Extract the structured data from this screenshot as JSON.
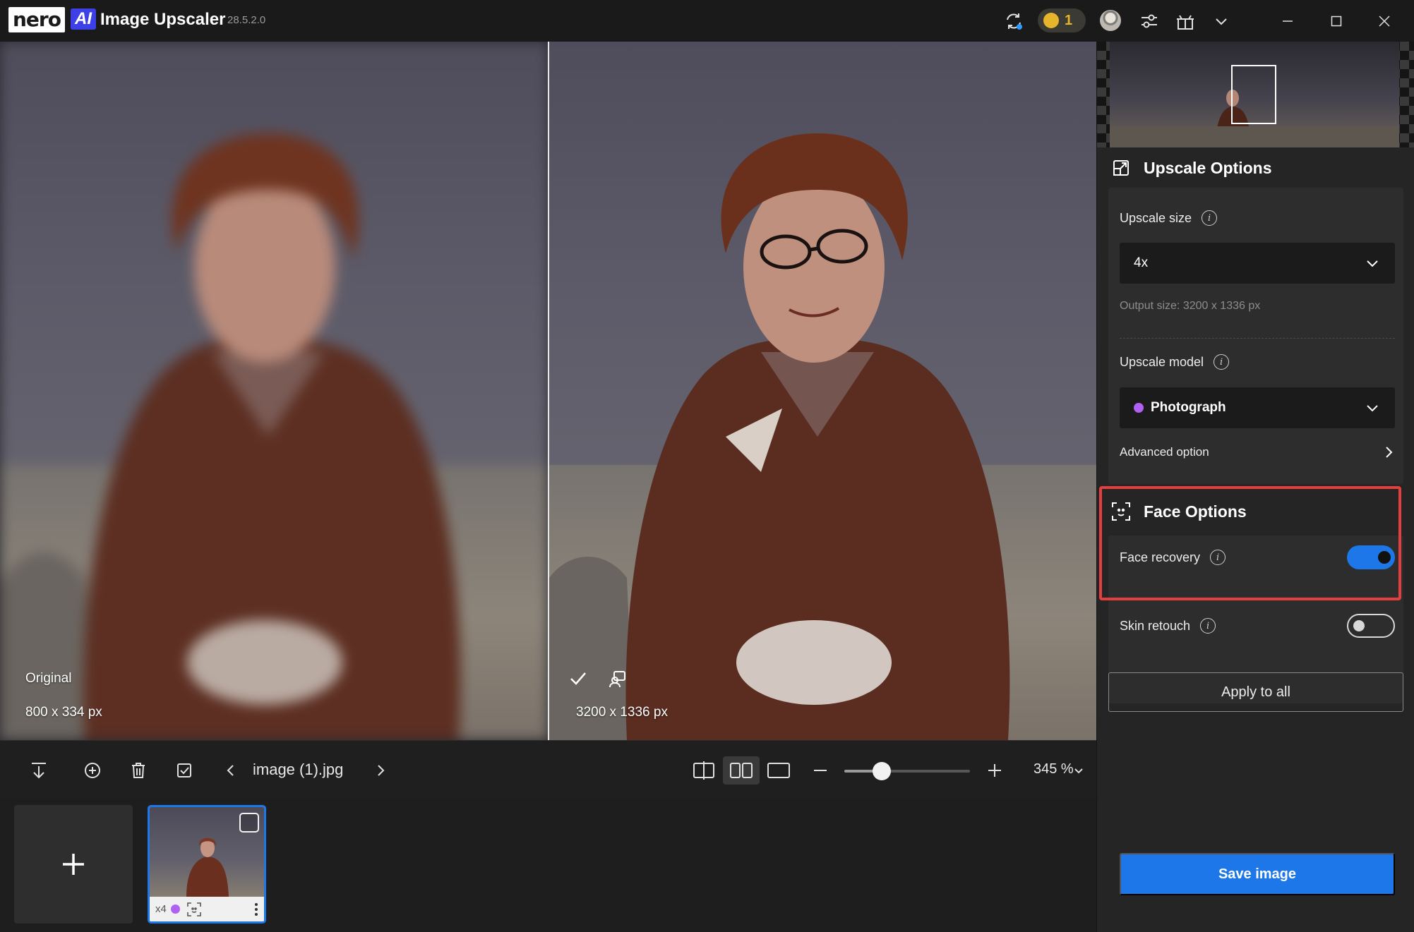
{
  "app": {
    "logo_brand": "nero",
    "logo_ai": "AI",
    "title": "Image Upscaler",
    "version": "28.5.2.0",
    "credits": "1",
    "icons": [
      "sync-icon",
      "coin-icon",
      "avatar",
      "settings-sliders-icon",
      "gift-icon",
      "chevron-down-icon",
      "minimize-icon",
      "maximize-icon",
      "close-icon"
    ]
  },
  "viewer": {
    "original_label": "Original",
    "original_size": "800 x 334 px",
    "upscaled_size": "3200 x 1336 px"
  },
  "toolbar": {
    "filename": "image (1).jpg",
    "zoom_value": "345 %",
    "zoom_slider_fraction": 0.3,
    "active_view": "side-by-side"
  },
  "thumbnails": [
    {
      "scale": "x4",
      "model_color": "#b061f2",
      "selected": true
    }
  ],
  "panel": {
    "upscale_options_title": "Upscale Options",
    "upscale_size_label": "Upscale size",
    "upscale_size_value": "4x",
    "output_size": "Output size: 3200 x 1336 px",
    "upscale_model_label": "Upscale model",
    "upscale_model_value": "Photograph",
    "model_color": "#b061f2",
    "advanced_option_label": "Advanced option",
    "face_options_title": "Face Options",
    "face_recovery_label": "Face recovery",
    "face_recovery_on": true,
    "skin_retouch_label": "Skin retouch",
    "skin_retouch_on": false,
    "apply_all_label": "Apply to all",
    "save_label": "Save image"
  },
  "colors": {
    "accent": "#1e77e8",
    "highlight": "#e53e3e",
    "coin": "#e5b52b",
    "model": "#b061f2"
  }
}
